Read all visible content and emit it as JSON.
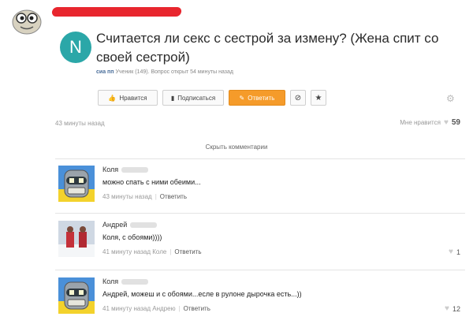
{
  "question": {
    "avatar_letter": "N",
    "title": "Считается ли секс с сестрой за измену? (Жена спит со своей сестрой)",
    "meta_author": "сиа пп",
    "meta_rest": "Ученик (149). Вопрос открыт 54 минуты назад",
    "time": "43 минуты назад",
    "likes_label": "Мне нравится",
    "likes_count": "59"
  },
  "actions": {
    "like_label": "Нравится",
    "subscribe_label": "Подписаться",
    "answer_label": "Ответить"
  },
  "hide_comments_label": "Скрыть комментарии",
  "comments": [
    {
      "name": "Коля",
      "text": "можно спать с ними обеими...",
      "time": "43 минуты назад",
      "reply_label": "Ответить",
      "likes": ""
    },
    {
      "name": "Андрей",
      "text": "Коля, с обоями))))",
      "time": "41 минуту назад Коле",
      "reply_label": "Ответить",
      "likes": "1"
    },
    {
      "name": "Коля",
      "text": "Андрей, можеш и с обоями...есле в рулоне дырочка есть...))",
      "time": "41 минуту назад Андрею",
      "reply_label": "Ответить",
      "likes": "12"
    }
  ],
  "colors": {
    "accent_orange": "#f59b2a",
    "avatar_teal": "#2ba7a8",
    "redaction_red": "#e8262e"
  }
}
